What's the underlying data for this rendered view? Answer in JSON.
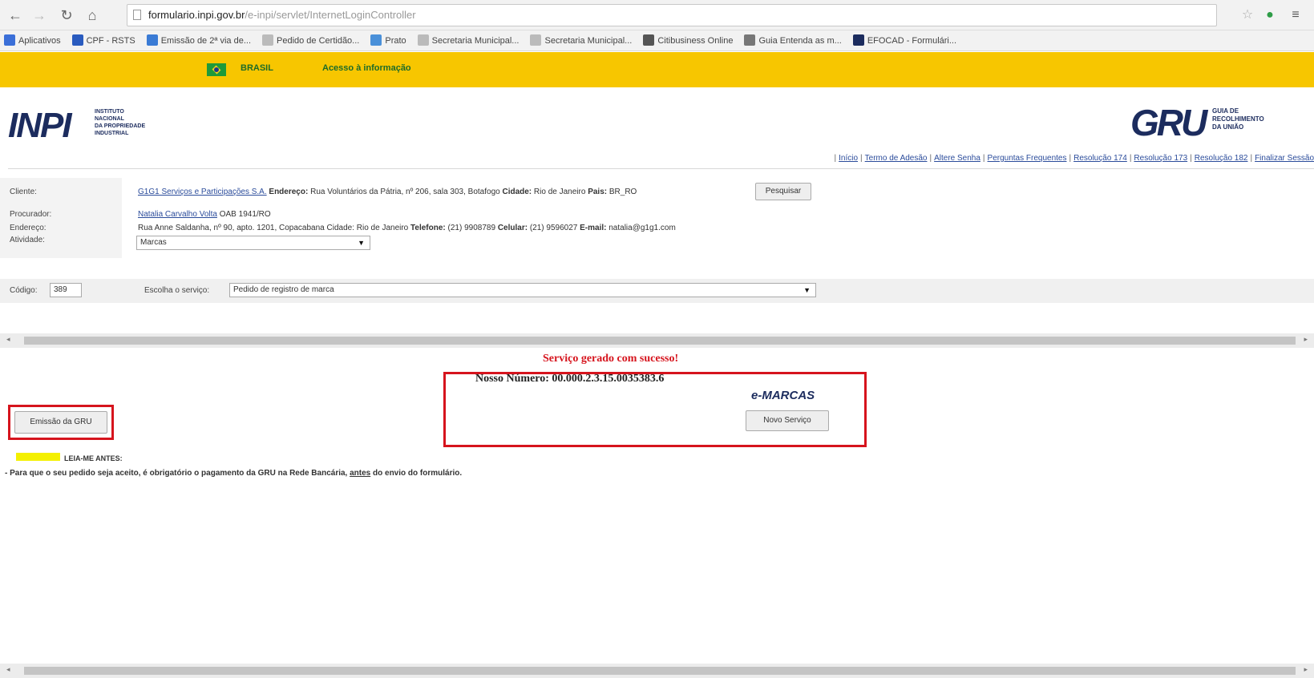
{
  "browser": {
    "url_domain": "formulario.inpi.gov.br",
    "url_path": "/e-inpi/servlet/InternetLoginController"
  },
  "bookmarks": [
    {
      "label": "Aplicativos",
      "color": "#3b6fd8"
    },
    {
      "label": "CPF - RSTS",
      "color": "#2a5bbf"
    },
    {
      "label": "Emissão de 2ª via de...",
      "color": "#3a7bd5"
    },
    {
      "label": "Pedido de Certidão...",
      "color": "#bbbbbb"
    },
    {
      "label": "Prato",
      "color": "#4a90d9"
    },
    {
      "label": "Secretaria Municipal...",
      "color": "#bbbbbb"
    },
    {
      "label": "Secretaria Municipal...",
      "color": "#bbbbbb"
    },
    {
      "label": "Citibusiness Online",
      "color": "#555555"
    },
    {
      "label": "Guia Entenda as m...",
      "color": "#777777"
    },
    {
      "label": "EFOCAD - Formulári...",
      "color": "#1c2c5e"
    }
  ],
  "gov_bar": {
    "brasil_label": "BRASIL",
    "access_label": "Acesso à informação"
  },
  "header": {
    "inpi_logo": "INPI",
    "inpi_subtitle": [
      "INSTITUTO",
      "NACIONAL",
      "DA PROPRIEDADE",
      "INDUSTRIAL"
    ],
    "gru_logo": "GRU",
    "gru_subtitle": [
      "GUIA DE",
      "RECOLHIMENTO",
      "DA UNIÃO"
    ],
    "links": [
      "Início",
      "Termo de Adesão",
      "Altere Senha",
      "Perguntas Frequentes",
      "Resolução 174",
      "Resolução 173",
      "Resolução 182",
      "Finalizar Sessão"
    ]
  },
  "client": {
    "labels": {
      "cliente": "Cliente:",
      "procurador": "Procurador:",
      "endereco": "Endereço:",
      "atividade": "Atividade:"
    },
    "cliente_name": "G1G1 Serviços e Participações S.A.",
    "cliente_endereco_label": "Endereço:",
    "cliente_endereco": "Rua Voluntários da Pátria, nº 206, sala 303, Botafogo",
    "cidade_label": "Cidade:",
    "cidade": "Rio de Janeiro",
    "uf_label": "Pais:",
    "uf": "BR_RO",
    "pesquisar_label": "Pesquisar",
    "procurador_name": "Natalia Carvalho Volta",
    "procurador_oab": "OAB 1941/RO",
    "endereco_value": "Rua Anne Saldanha, nº 90, apto. 1201, Copacabana",
    "endereco_cidade_label": "Cidade:",
    "endereco_cidade": "Rio de Janeiro",
    "telefone_label": "Telefone:",
    "telefone": "(21) 9908789",
    "celular_label": "Celular:",
    "celular": "(21) 9596027",
    "email_label": "E-mail:",
    "email": "natalia@g1g1.com",
    "atividade_value": "Marcas"
  },
  "service": {
    "codigo_label": "Código:",
    "codigo_value": "389",
    "escolha_label": "Escolha o serviço:",
    "servico_value": "Pedido de registro de marca"
  },
  "result": {
    "title": "Serviço gerado com sucesso!",
    "nosso_numero_label": "Nosso Número:",
    "nosso_numero": "00.000.2.3.15.0035383.6",
    "emarcas": "e-MARCAS",
    "novo_servico_label": "Novo Serviço",
    "emissao_label": "Emissão da GRU"
  },
  "notice": {
    "leia_label": "LEIA-ME ANTES:",
    "text_before": "- Para que o seu pedido seja aceito, é obrigatório o pagamento da GRU na Rede Bancária,",
    "text_underlined": "antes",
    "text_after": "do envio do formulário."
  }
}
